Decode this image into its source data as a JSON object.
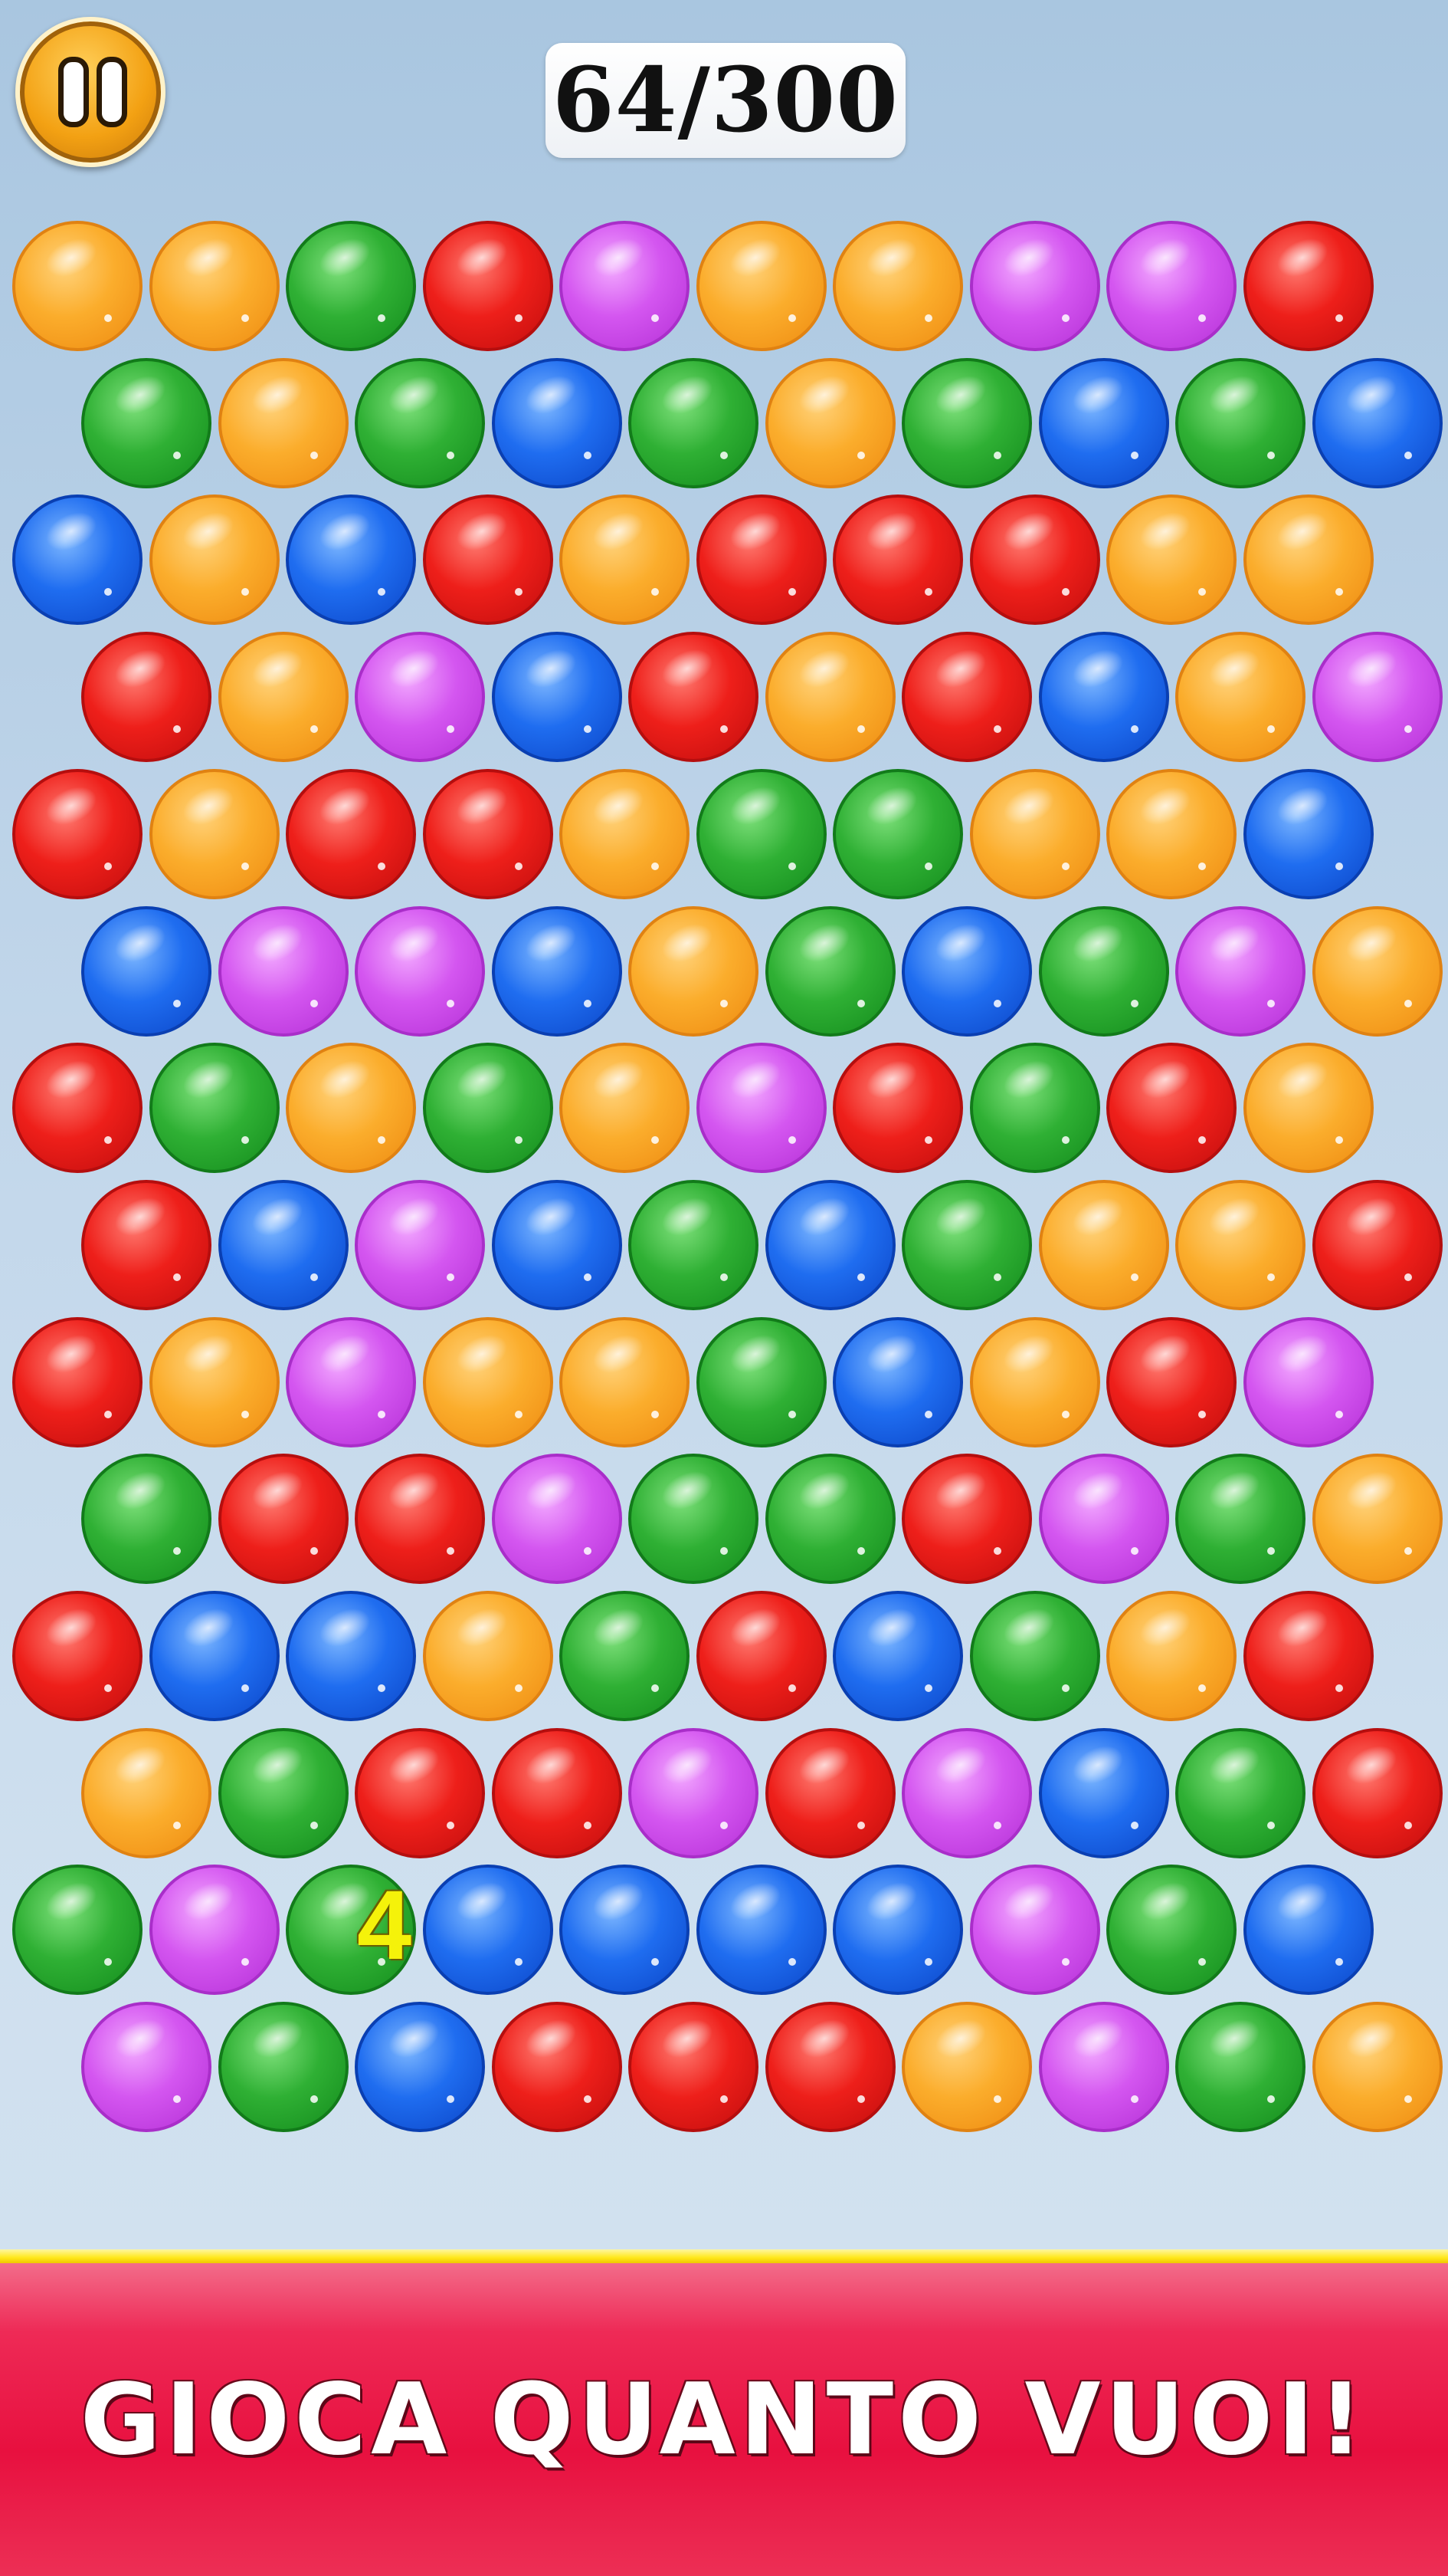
{
  "hud": {
    "score": "64/300",
    "pause_icon": "pause-icon"
  },
  "board": {
    "rows": [
      [
        "orange",
        "orange",
        "green",
        "red",
        "purple",
        "orange",
        "orange",
        "purple",
        "purple",
        "red"
      ],
      [
        "green",
        "orange",
        "green",
        "blue",
        "green",
        "orange",
        "green",
        "blue",
        "green",
        "blue"
      ],
      [
        "blue",
        "orange",
        "blue",
        "red",
        "orange",
        "red",
        "red",
        "red",
        "orange",
        "orange"
      ],
      [
        "red",
        "orange",
        "purple",
        "blue",
        "red",
        "orange",
        "red",
        "blue",
        "orange",
        "purple"
      ],
      [
        "red",
        "orange",
        "red",
        "red",
        "orange",
        "green",
        "green",
        "orange",
        "orange",
        "blue"
      ],
      [
        "blue",
        "purple",
        "purple",
        "blue",
        "orange",
        "green",
        "blue",
        "green",
        "purple",
        "orange"
      ],
      [
        "red",
        "green",
        "orange",
        "green",
        "orange",
        "purple",
        "red",
        "green",
        "red",
        "orange"
      ],
      [
        "red",
        "blue",
        "purple",
        "blue",
        "green",
        "blue",
        "green",
        "orange",
        "orange",
        "red"
      ],
      [
        "red",
        "orange",
        "purple",
        "orange",
        "orange",
        "green",
        "blue",
        "orange",
        "red",
        "purple"
      ],
      [
        "green",
        "red",
        "red",
        "purple",
        "green",
        "green",
        "red",
        "purple",
        "green",
        "orange"
      ],
      [
        "red",
        "blue",
        "blue",
        "orange",
        "green",
        "red",
        "blue",
        "green",
        "orange",
        "red"
      ],
      [
        "orange",
        "green",
        "red",
        "red",
        "purple",
        "red",
        "purple",
        "blue",
        "green",
        "red"
      ],
      [
        "green",
        "purple",
        "green",
        "blue",
        "blue",
        "blue",
        "blue",
        "purple",
        "green",
        "blue"
      ],
      [
        "purple",
        "green",
        "blue",
        "red",
        "red",
        "red",
        "orange",
        "purple",
        "green",
        "orange"
      ]
    ],
    "combo_number": "4"
  },
  "banner": {
    "text": "GIOCA QUANTO VUOI!"
  },
  "colors": {
    "background": "#c1d6ea",
    "banner": "#e8103f",
    "banner_line": "#ffe81a"
  }
}
